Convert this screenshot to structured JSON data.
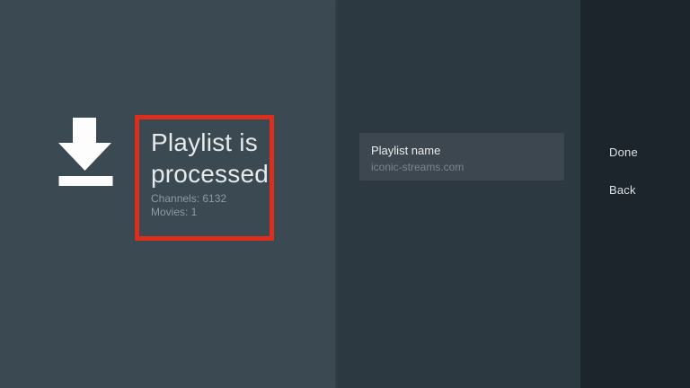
{
  "left_panel": {
    "icon": "download-icon",
    "status_title": "Playlist is processed",
    "stats": {
      "channels": "Channels: 6132",
      "movies": "Movies: 1"
    }
  },
  "form_panel": {
    "fields": {
      "playlist_name": {
        "label": "Playlist name",
        "value": "iconic-streams.com"
      }
    }
  },
  "action_panel": {
    "done": "Done",
    "back": "Back"
  },
  "colors": {
    "left_bg": "#3a4952",
    "middle_bg": "#2c3941",
    "right_bg": "#1d252c",
    "card_bg": "#3d474f",
    "title_text": "#e5e9ea",
    "muted_text": "#8f9aa1",
    "action_text": "#dce0e2",
    "icon_fill": "#fdfdfd",
    "highlight_red": "#dd2e1c"
  }
}
